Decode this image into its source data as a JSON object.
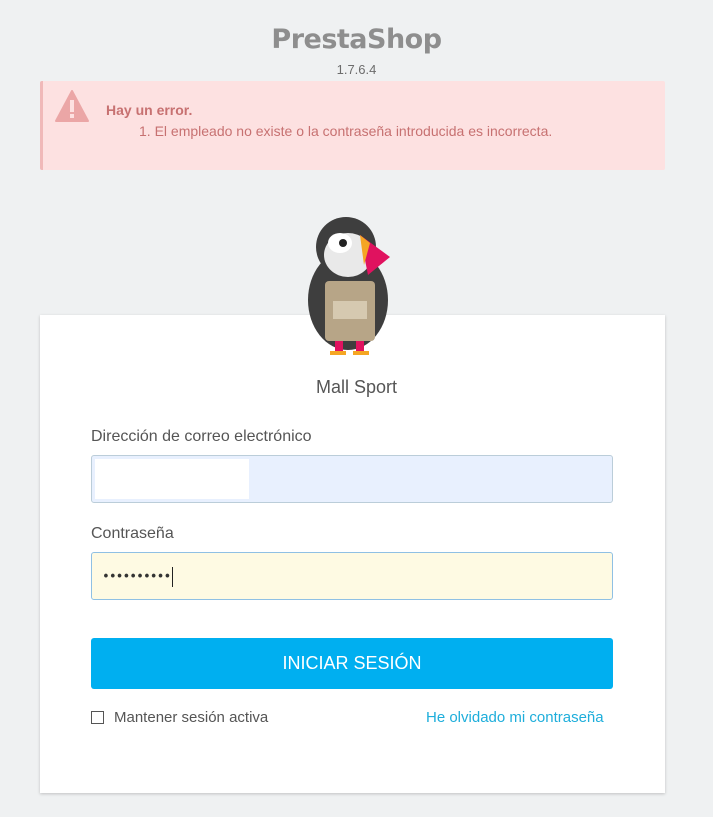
{
  "brand": {
    "logo_text": "PrestaShop",
    "version": "1.7.6.4"
  },
  "alert": {
    "title": "Hay un error.",
    "message": "1. El empleado no existe o la contraseña introducida es incorrecta.",
    "icon": "warning-icon",
    "color": "#fde1e1"
  },
  "login": {
    "shop_name": "Mall Sport",
    "email_label": "Dirección de correo electrónico",
    "email_value": "",
    "password_label": "Contraseña",
    "password_value": "••••••••••",
    "submit_label": "INICIAR SESIÓN",
    "remember_label": "Mantener sesión activa",
    "forgot_label": "He olvidado mi contraseña",
    "accent_color": "#00aff0"
  }
}
